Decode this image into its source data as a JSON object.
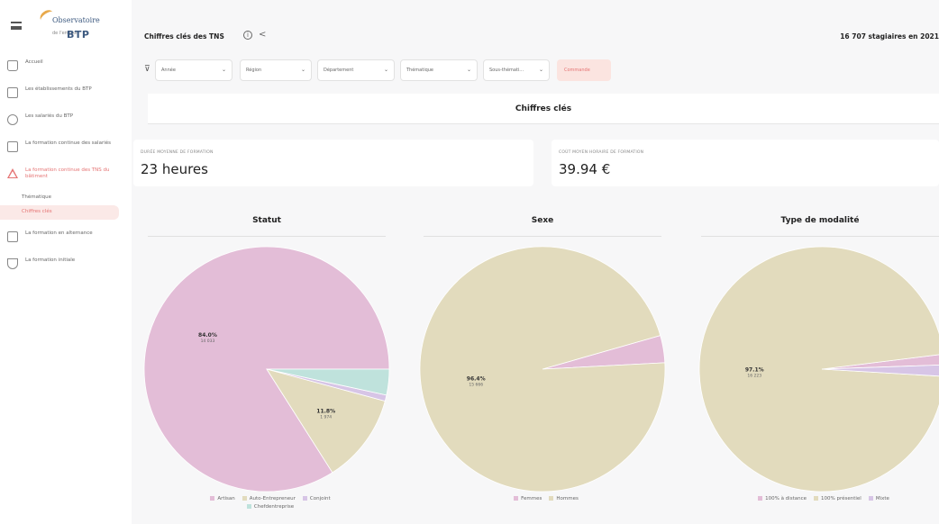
{
  "sidebar": {
    "logo_line1": "Observatoire",
    "logo_line2": "BTP",
    "logo_line3": "de l'emploi",
    "items": [
      {
        "label": "Accueil",
        "icon": "home-icon"
      },
      {
        "label": "Les établissements du BTP",
        "icon": "building-icon"
      },
      {
        "label": "Les salariés du BTP",
        "icon": "users-icon"
      },
      {
        "label": "La formation continue des salariés",
        "icon": "book-icon"
      },
      {
        "label": "La formation continue des TNS du bâtiment",
        "icon": "alert-icon",
        "active": true
      },
      {
        "label": "La formation en alternance",
        "icon": "document-icon"
      },
      {
        "label": "La formation initiale",
        "icon": "graduation-icon"
      }
    ],
    "sub_items": [
      "Thématique",
      "Chiffres clés"
    ]
  },
  "header": {
    "title": "Chiffres clés des TNS",
    "count_text": "16 707 stagiaires en 2021"
  },
  "filters": [
    "Année",
    "Région",
    "Département",
    "Thématique",
    "Sous-thémati..."
  ],
  "filter_button": "Commande",
  "section_title": "Chiffres clés",
  "kpis": [
    {
      "label": "Durée moyenne de formation",
      "value": "23 heures"
    },
    {
      "label": "Coût moyen horaire de formation",
      "value": "39.94 €"
    }
  ],
  "colors": {
    "pink": "#e3bdd7",
    "beige": "#e2dbbd",
    "lavender": "#d7c5e6",
    "mint": "#bfe2dc",
    "accent": "#e57373"
  },
  "chart_data": [
    {
      "type": "pie",
      "title": "Statut",
      "categories": [
        "Artisan",
        "Auto-Entrepreneur",
        "Conjoint",
        "Chefdentreprise"
      ],
      "values": [
        84.0,
        11.8,
        0.8,
        3.4
      ],
      "labels_shown": [
        {
          "category": "Artisan",
          "pct": "84.0%",
          "count": "14 033"
        },
        {
          "category": "Auto-Entrepreneur",
          "pct": "11.8%",
          "count": "1 974"
        }
      ],
      "legend": "bottom"
    },
    {
      "type": "pie",
      "title": "Sexe",
      "categories": [
        "Femmes",
        "Hommes"
      ],
      "values": [
        3.6,
        96.4
      ],
      "labels_shown": [
        {
          "category": "Hommes",
          "pct": "96.4%",
          "count": "15 666"
        }
      ],
      "legend": "bottom"
    },
    {
      "type": "pie",
      "title": "Type de modalité",
      "categories": [
        "100% à distance",
        "100% présentiel",
        "Mixte"
      ],
      "values": [
        1.4,
        97.1,
        1.5
      ],
      "labels_shown": [
        {
          "category": "100% présentiel",
          "pct": "97.1%",
          "count": "16 223"
        }
      ],
      "legend": "bottom"
    }
  ]
}
